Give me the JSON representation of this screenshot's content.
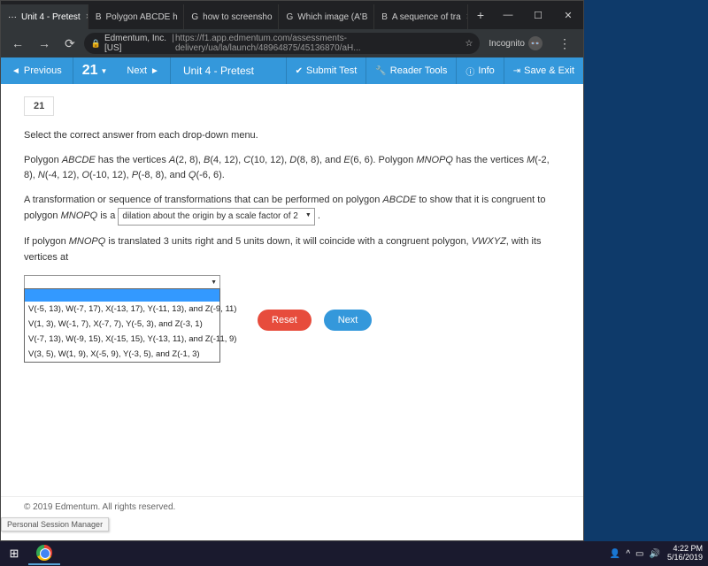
{
  "browser": {
    "tabs": [
      {
        "title": "Unit 4 - Pretest",
        "icon": "···"
      },
      {
        "title": "Polygon ABCDE h",
        "icon": "B"
      },
      {
        "title": "how to screensho",
        "icon": "G"
      },
      {
        "title": "Which image (A'B",
        "icon": "G"
      },
      {
        "title": "A sequence of tra",
        "icon": "B"
      }
    ],
    "url_host": "Edmentum, Inc. [US]",
    "url_path": "https://f1.app.edmentum.com/assessments-delivery/ua/la/launch/48964875/45136870/aH...",
    "incognito": "Incognito"
  },
  "header": {
    "prev": "Previous",
    "qnum": "21",
    "next": "Next",
    "title": "Unit 4 - Pretest",
    "submit": "Submit Test",
    "tools": "Reader Tools",
    "info": "Info",
    "save": "Save & Exit"
  },
  "question": {
    "number": "21",
    "prompt": "Select the correct answer from each drop-down menu.",
    "body1a": "Polygon ",
    "body1b": "ABCDE",
    "body1c": " has the vertices ",
    "body1d": "A",
    "body1e": "(2, 8), ",
    "body1f": "B",
    "body1g": "(4, 12), ",
    "body1h": "C",
    "body1i": "(10, 12), ",
    "body1j": "D",
    "body1k": "(8, 8), and ",
    "body1l": "E",
    "body1m": "(6, 6). Polygon ",
    "body1n": "MNOPQ",
    "body1o": " has the vertices ",
    "body1p": "M",
    "body1q": "(-2, 8), ",
    "body1r": "N",
    "body1s": "(-4, 12), ",
    "body1t": "O",
    "body1u": "(-10, 12), ",
    "body1v": "P",
    "body1w": "(-8, 8), and ",
    "body1x": "Q",
    "body1y": "(-6, 6).",
    "body2a": "A transformation or sequence of transformations that can be performed on polygon ",
    "body2b": "ABCDE",
    "body2c": " to show that it is congruent to polygon ",
    "body2d": "MNOPQ",
    "body2e": " is a ",
    "dd1": "dilation about the origin by a scale factor of 2",
    "body3a": "If polygon ",
    "body3b": "MNOPQ",
    "body3c": " is translated 3 units right and 5 units down, it will coincide with a congruent polygon, ",
    "body3d": "VWXYZ",
    "body3e": ", with its vertices at",
    "options": [
      "",
      "V(-5, 13), W(-7, 17), X(-13, 17), Y(-11, 13), and Z(-9, 11)",
      "V(1, 3), W(-1, 7), X(-7, 7), Y(-5, 3), and Z(-3, 1)",
      "V(-7, 13), W(-9, 15), X(-15, 15), Y(-13, 11), and Z(-11, 9)",
      "V(3, 5), W(1, 9), X(-5, 9), Y(-3, 5), and Z(-1, 3)"
    ],
    "reset": "Reset",
    "nextbtn": "Next"
  },
  "footer": "© 2019 Edmentum. All rights reserved.",
  "session": "Personal Session Manager",
  "clock": {
    "time": "4:22 PM",
    "date": "5/16/2019"
  }
}
